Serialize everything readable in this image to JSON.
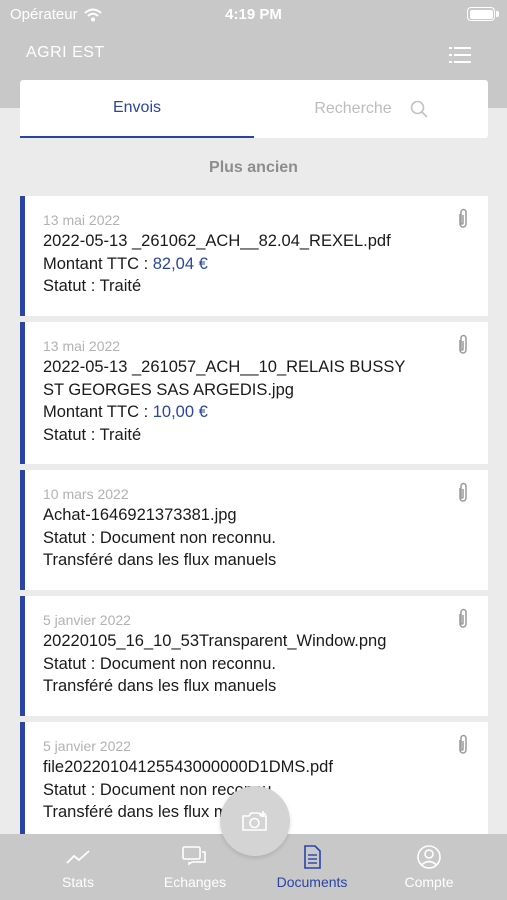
{
  "status_bar": {
    "carrier": "Opérateur",
    "time": "4:19 PM"
  },
  "nav": {
    "title": "AGRI EST",
    "menu_icon": "list-menu-icon"
  },
  "tabs": {
    "envois": "Envois",
    "recherche": "Recherche"
  },
  "section": {
    "heading": "Plus ancien"
  },
  "documents": [
    {
      "date": "13 mai 2022",
      "lines": [
        "2022-05-13 _261062_ACH__82.04_REXEL.pdf"
      ],
      "amount_label": "Montant TTC : ",
      "amount_value": "82,04 €",
      "status": "Statut : Traité"
    },
    {
      "date": "13 mai 2022",
      "lines": [
        "2022-05-13 _261057_ACH__10_RELAIS BUSSY",
        "ST GEORGES SAS ARGEDIS.jpg"
      ],
      "amount_label": "Montant TTC : ",
      "amount_value": "10,00 €",
      "status": "Statut : Traité"
    },
    {
      "date": "10 mars 2022",
      "lines": [
        "Achat-1646921373381.jpg"
      ],
      "status": "Statut : Document non reconnu.",
      "note": "Transféré dans les flux manuels"
    },
    {
      "date": "5 janvier 2022",
      "lines": [
        "20220105_16_10_53Transparent_Window.png"
      ],
      "status": "Statut : Document non reconnu.",
      "note": "Transféré dans les flux manuels"
    },
    {
      "date": "5 janvier 2022",
      "lines": [
        "file20220104125543000000D1DMS.pdf"
      ],
      "status": "Statut : Document non reconnu.",
      "note": "Transféré dans les flux manuels"
    }
  ],
  "tab_bar": {
    "stats": "Stats",
    "echanges": "Echanges",
    "documents": "Documents",
    "compte": "Compte"
  },
  "colors": {
    "accent": "#2a44a6",
    "header_gray": "#c8c8c8",
    "background": "#ebebeb"
  }
}
